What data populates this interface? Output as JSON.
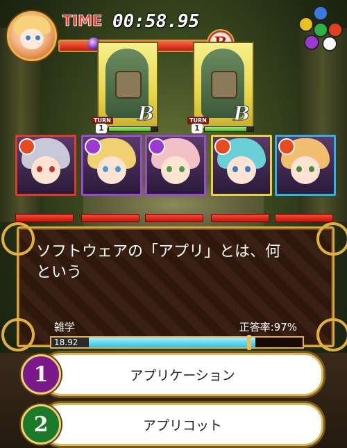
{
  "hud": {
    "time_label": "TIME",
    "time_value": "00:58.95",
    "timer_progress": 0.92,
    "boss_badge": "B"
  },
  "enemies": [
    {
      "rank": "B",
      "turn_label": "TURN",
      "turn": "1",
      "hp": 0.85
    },
    {
      "rank": "B",
      "turn_label": "TURN",
      "turn": "1",
      "hp": 0.85
    }
  ],
  "party": [
    {
      "element": "fire",
      "frame_color": "#e03a2a",
      "hair": "#c8c8d8",
      "eyes": "#c03030"
    },
    {
      "element": "dark",
      "frame_color": "#9a4ad0",
      "hair": "#f0d070",
      "eyes": "#40a0d0"
    },
    {
      "element": "dark",
      "frame_color": "#9a4ad0",
      "hair": "#f4c0c8",
      "eyes": "#4aa040"
    },
    {
      "element": "fire",
      "frame_color": "#e8d040",
      "hair": "#6ad0d8",
      "eyes": "#3a7ac0"
    },
    {
      "element": "fire",
      "frame_color": "#30b0e0",
      "hair": "#f0c070",
      "eyes": "#4a8a40"
    }
  ],
  "quiz": {
    "question_line1": "ソフトウェアの「アプリ」とは、何",
    "question_line2": "という",
    "category": "雑学",
    "accuracy": "正答率:97%",
    "answer_time": "18.92",
    "answer_progress": 0.78
  },
  "choices": [
    {
      "number": "1",
      "label": "アプリケーション",
      "color": "#7a1a8a"
    },
    {
      "number": "2",
      "label": "アプリコット",
      "color": "#1a7a2a"
    }
  ]
}
